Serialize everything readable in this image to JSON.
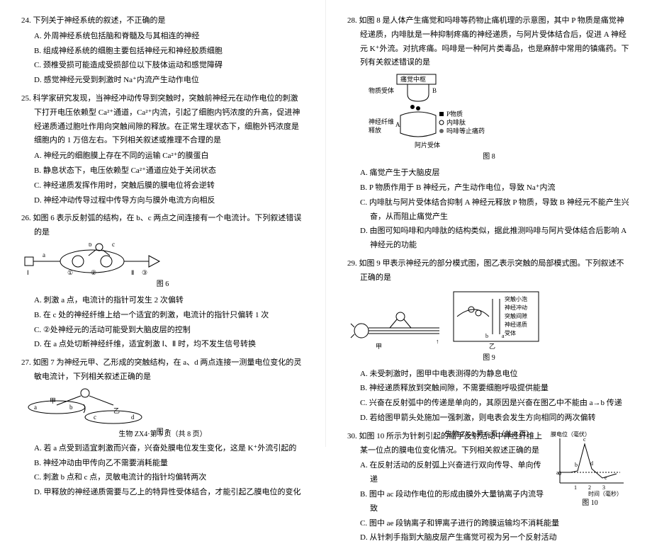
{
  "footer_left": "生物 ZX4·第 5 页（共 8 页）",
  "footer_right": "生物 ZX4·第 6 页（共 8 页）",
  "q24": {
    "stem": "24. 下列关于神经系统的叙述，不正确的是",
    "A": "A. 外周神经系统包括脑和脊髓及与其相连的神经",
    "B": "B. 组成神经系统的细胞主要包括神经元和神经胶质细胞",
    "C": "C. 颈椎受损可能造成受损部位以下肢体运动和感觉障碍",
    "D": "D. 感觉神经元受到刺激时 Na⁺内流产生动作电位"
  },
  "q25": {
    "stem": "25. 科学家研究发现，当神经冲动传导到突触时，突触前神经元在动作电位的刺激下打开电压依赖型 Ca²⁺通道，Ca²⁺内流，引起了细胞内钙浓度的升高，促进神经递质通过胞吐作用向突触间隙的释放。在正常生理状态下，细胞外钙浓度是细胞内的 1 万倍左右。下列相关叙述或推理不合理的是",
    "A": "A. 神经元的细胞膜上存在不同的运输 Ca²⁺的膜蛋白",
    "B": "B. 静息状态下，电压依赖型 Ca²⁺通道应处于关闭状态",
    "C": "C. 神经递质发挥作用时，突触后膜的膜电位将会逆转",
    "D": "D. 神经冲动传导过程中传导方向与膜外电流方向相反"
  },
  "q26": {
    "stem": "26. 如图 6 表示反射弧的结构，在 b、c 两点之间连接有一个电流计。下列叙述错误的是",
    "caption": "图 6",
    "A": "A. 刺激 a 点，电流计的指针可发生 2 次偏转",
    "B": "B. 在 c 处的神经纤维上给一个适宜的刺激，电流计的指针只偏转 1 次",
    "C": "C. ②处神经元的活动可能受到大脑皮层的控制",
    "D": "D. 在 a 点处切断神经纤维，适宜刺激 Ⅰ、Ⅱ 时，均不发生信号转换"
  },
  "q27": {
    "stem": "27. 如图 7 为神经元甲、乙形成的突触结构，在 a、d 两点连接一测量电位变化的灵敏电流计，下列相关叙述正确的是",
    "caption": "图 7",
    "A": "A. 若 a 点受到适宜刺激而兴奋，兴奋处膜电位发生变化，这是 K⁺外流引起的",
    "B": "B. 神经冲动由甲传向乙不需要消耗能量",
    "C": "C. 刺激 b 点和 c 点，灵敏电流计的指针均偏转两次",
    "D": "D. 甲释放的神经递质需要与乙上的特异性受体结合，才能引起乙膜电位的变化"
  },
  "q28": {
    "stem": "28. 如图 8 是人体产生痛觉和吗啡等药物止痛机理的示意图，其中 P 物质是痛觉神经递质，内啡肽是一种抑制疼痛的神经递质，与阿片受体结合后，促进 A 神经元 K⁺外流。对抗疼痛。吗啡是一种阿片类毒品，也是麻醉中常用的镇痛药。下列有关叙述错误的是",
    "caption": "图 8",
    "labels": {
      "center": "痛觉中枢",
      "receptor": "物质受体",
      "axon": "神经纤维",
      "release": "释放",
      "p": "P物质",
      "endo": "内啡肽",
      "morphine": "吗啡等止痛药",
      "opioid": "阿片受体"
    },
    "A": "A. 痛觉产生于大脑皮层",
    "B": "B. P 物质作用于 B 神经元，产生动作电位，导致 Na⁺内流",
    "C": "C. 内啡肽与阿片受体结合抑制 A 神经元释放 P 物质，导致 B 神经元不能产生兴奋，从而阻止痛觉产生",
    "D": "D. 由图可知吗啡和内啡肽的结构类似，据此推测吗啡与阿片受体结合后影响 A 神经元的功能"
  },
  "q29": {
    "stem": "29. 如图 9 甲表示神经元的部分模式图，图乙表示突触的局部模式图。下列叙述不正确的是",
    "caption": "图 9",
    "labels": {
      "jia": "甲",
      "yi": "乙",
      "vesicle": "突触小泡",
      "signal": "神经冲动",
      "gap": "突触间隙",
      "trans": "神经递质",
      "receptor": "受体"
    },
    "A": "A. 未受刺激时，图甲中电表测得的为静息电位",
    "B": "B. 神经递质释放到突触间隙，不需要细胞呼吸提供能量",
    "C": "C. 兴奋在反射弧中的传递是单向的，其原因是兴奋在图乙中不能由 a→b 传递",
    "D": "D. 若给图甲箭头处施加一强刺激，则电表会发生方向相同的两次偏转"
  },
  "q30": {
    "stem": "30. 如图 10 所示为针刺引起的缩手反射活动中神经纤维上某一位点的膜电位变化情况。下列相关叙述正确的是",
    "caption": "图 10",
    "chart": {
      "ylabel": "膜电位（毫伏）",
      "xlabel": "时间（毫秒）",
      "xticks": [
        "1",
        "2",
        "3"
      ],
      "letters": [
        "a",
        "b",
        "c",
        "d",
        "e"
      ]
    },
    "A": "A. 在反射活动的反射弧上兴奋进行双向传导、单向传递",
    "B": "B. 图中 ac 段动作电位的形成由膜外大量钠离子内流导致",
    "C": "C. 图中 ae 段钠离子和钾离子进行的跨膜运输均不消耗能量",
    "D": "D. 从针刺手指到大脑皮层产生痛觉可视为另一个反射活动"
  }
}
